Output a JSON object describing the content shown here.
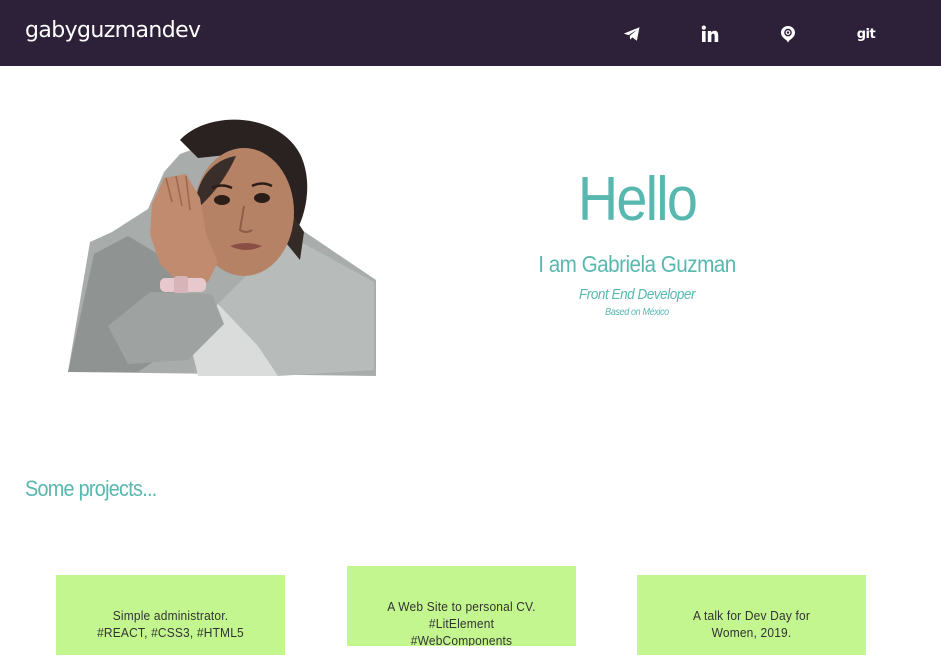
{
  "navbar": {
    "brand": "gabyguzmandev",
    "icons": [
      {
        "name": "telegram-icon"
      },
      {
        "name": "linkedin-icon"
      },
      {
        "name": "email-icon"
      },
      {
        "name": "git-icon",
        "text": "git"
      }
    ]
  },
  "hero": {
    "greeting": "Hello",
    "intro": "I am Gabriela Guzman",
    "role": "Front End Developer",
    "location": "Based on México"
  },
  "projects": {
    "title": "Some projects...",
    "cards": [
      {
        "lines": [
          "Simple administrator.",
          "#REACT, #CSS3, #HTML5"
        ]
      },
      {
        "lines": [
          "A Web Site to personal CV.",
          "#LitElement",
          "#WebComponents"
        ]
      },
      {
        "lines": [
          "A talk for Dev Day for",
          "Women, 2019."
        ]
      }
    ]
  },
  "colors": {
    "navbar_bg": "#2c2138",
    "accent": "#58b8b0",
    "card_bg": "#c3f68f"
  }
}
